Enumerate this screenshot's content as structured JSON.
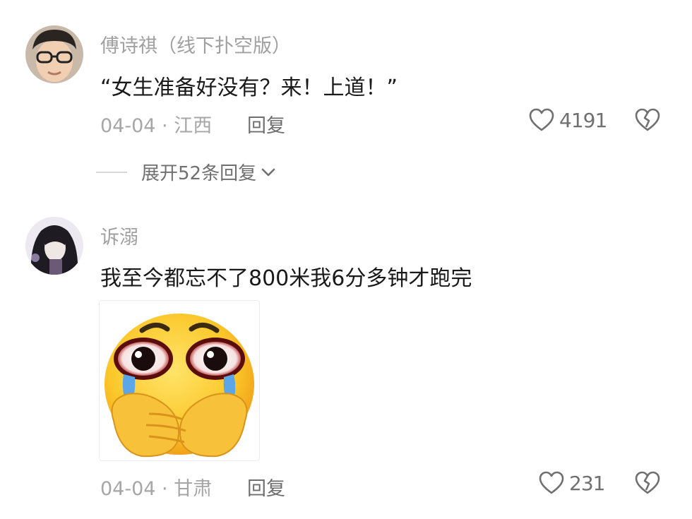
{
  "comments": [
    {
      "username": "傅诗祺（线下扑空版）",
      "text": "“女生准备好没有？来！上道！”",
      "date_location": "04-04 · 江西",
      "reply_label": "回复",
      "likes": "4191",
      "expand_label": "展开52条回复"
    },
    {
      "username": "诉溺",
      "text": "我至今都忘不了800米我6分多钟才跑完",
      "date_location": "04-04 · 甘肃",
      "reply_label": "回复",
      "likes": "231"
    }
  ],
  "icons": {
    "like": "heart-outline-icon",
    "dislike": "broken-heart-icon",
    "expand": "chevron-down-icon",
    "sticker": "crying-face-emoji-sticker"
  },
  "colors": {
    "username": "#a0a0a0",
    "text": "#1a1a1a",
    "meta": "#a6a6a6",
    "icon": "#707070"
  }
}
